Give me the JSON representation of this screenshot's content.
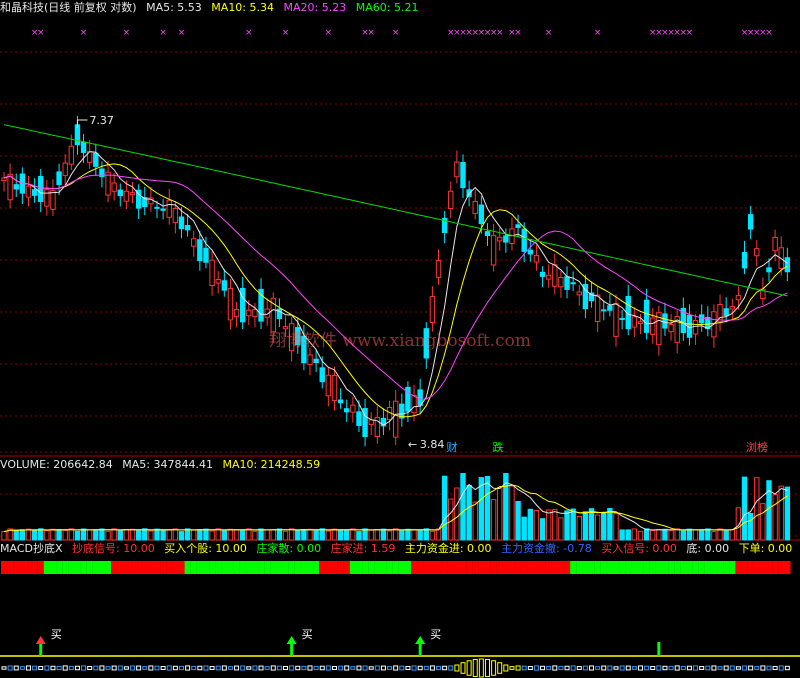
{
  "stock_header": {
    "title": "和晶科技(日线 前复权 对数)",
    "ma5": "MA5: 5.53",
    "ma10": "MA10: 5.34",
    "ma20": "MA20: 5.23",
    "ma60": "MA60: 5.21"
  },
  "price_annotations": {
    "high_label": "7.37",
    "low_label": "3.84",
    "tag_cai": "财",
    "tag_die": "跌",
    "tag_liubang": "浏榜"
  },
  "watermark": "翔博软件 www.xiangbosoft.com",
  "volume_header": {
    "volume": "VOLUME: 206642.84",
    "ma5": "MA5: 347844.41",
    "ma10": "MA10: 214248.59"
  },
  "indicator_header": {
    "name": "MACD抄底X",
    "chaodi": "抄底信号: 10.00",
    "mairu_gegu": "买入个股: 10.00",
    "zhuangjia_san": "庄家散: 0.00",
    "zhuangjia_jin": "庄家进: 1.59",
    "zhuli_jin": "主力资金进: 0.00",
    "zhuli_jinqu": "主力资金撤: -0.78",
    "mairu_xinhao": "买入信号: 0.00",
    "di": "底: 0.00",
    "xiadan": "下单: 0.00"
  },
  "buy_signals": [
    "买",
    "买",
    "买"
  ],
  "colors": {
    "up": "#ff3333",
    "down": "#00e5ff",
    "ma5": "#e6e6e6",
    "ma10": "#ffff00",
    "ma20": "#ff44ff",
    "ma60": "#00dd00",
    "grid": "#8a0000",
    "bg": "#000000"
  },
  "chart_data": {
    "type": "candlestick",
    "candle_count": 129,
    "price_range": [
      3.84,
      7.37
    ],
    "price_scale": "log",
    "series": [
      {
        "name": "MA5",
        "last": 5.53
      },
      {
        "name": "MA10",
        "last": 5.34
      },
      {
        "name": "MA20",
        "last": 5.23
      },
      {
        "name": "MA60",
        "last": 5.21
      }
    ],
    "volume_series": [
      {
        "name": "VOLUME",
        "last": 206642.84
      },
      {
        "name": "MA5",
        "last": 347844.41
      },
      {
        "name": "MA10",
        "last": 214248.59
      }
    ]
  }
}
